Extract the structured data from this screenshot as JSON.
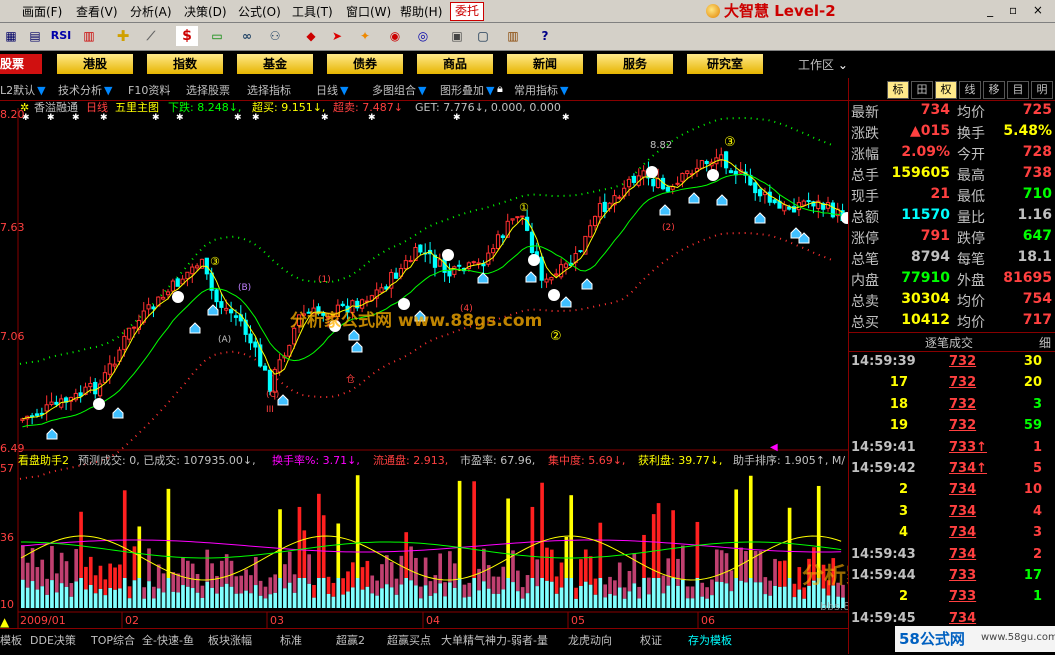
{
  "menu": {
    "items": [
      "画面(F)",
      "查看(V)",
      "分析(A)",
      "决策(D)",
      "公式(O)",
      "工具(T)",
      "窗口(W)",
      "帮助(H)"
    ],
    "entrust": "委托"
  },
  "logo": {
    "text": "大智慧 Level-2"
  },
  "toolbar": {
    "icons": [
      "grid-icon",
      "chart-icon",
      "rsi-icon",
      "indicator-icon",
      "crosshair-icon",
      "ruler-icon",
      "dollar-icon",
      "tape-icon",
      "binoculars-icon",
      "people-icon",
      "diamond-icon",
      "arrow-icon",
      "cross-icon",
      "clipboard-icon",
      "window-icon",
      "books-icon",
      "help-icon"
    ],
    "rsi_label": "RSI",
    "dollar_label": "$"
  },
  "tabs": {
    "left": "股票",
    "items": [
      "港股",
      "指数",
      "基金",
      "债券",
      "商品",
      "新闻",
      "服务",
      "研究室"
    ],
    "workarea": "工作区"
  },
  "indbar": {
    "items": [
      "L2默认",
      "技术分析",
      "F10资料",
      "选择股票",
      "选择指标",
      "日线",
      "多图组合",
      "图形叠加",
      "常用指标"
    ]
  },
  "chart": {
    "header": {
      "name": "香溢融通",
      "period": "日线",
      "indicator": "五里主图",
      "p1": "下跌: 8.248↓,",
      "p2": "超买: 9.151↓,",
      "p3": "超卖: 7.487↓",
      "p4": "GET: 7.776↓, 0.000, 0.000"
    },
    "price_ticks": [
      "8.20",
      "7.63",
      "7.06",
      "6.49"
    ],
    "annot": {
      "high": "8.82",
      "c1": "①",
      "c2": "②",
      "c3a": "③",
      "c3b": "③",
      "A": "(A)",
      "B": "(B)",
      "C": "(C)",
      "III": "III",
      "one": "(1)",
      "two": "(2)",
      "four": "(4)",
      "cang": "仓"
    },
    "watermark": "分析家公式网 www.88gs.com",
    "sub_header": {
      "name": "看盘助手2",
      "t1": "预测成交: 0, 已成交: 107935.00↓,",
      "t2": "换手率%: 3.71↓,",
      "t3": "流通盘: 2.913,",
      "t4": "市盈率: 67.96,",
      "t5": "集中度: 5.69↓,",
      "t6": "获利盘: 39.77↓,",
      "t7": "助手排序: 1.905↑, M/"
    },
    "vol_ticks": [
      "57",
      "36",
      "10"
    ],
    "date_labels": [
      "2009/01",
      "02",
      "03",
      "04",
      "05",
      "06"
    ],
    "watermark2": "分析家论坛",
    "watermark3": "bbs.88gs.com"
  },
  "chart_data": {
    "type": "candlestick",
    "title": "香溢融通",
    "x_start": "2009/01",
    "months": [
      "2009/01",
      "02",
      "03",
      "04",
      "05",
      "06"
    ],
    "ylim": [
      6.2,
      8.4
    ],
    "high_mark": 8.82
  },
  "rpanel": {
    "tabs": [
      "标",
      "田",
      "权",
      "线",
      "移",
      "目",
      "明"
    ],
    "quote": [
      {
        "l1": "最新",
        "v1": "734",
        "l2": "均价",
        "v2": "725",
        "c1": "#ff4040",
        "c2": "#ff4040"
      },
      {
        "l1": "涨跌",
        "v1": "▲015",
        "l2": "换手",
        "v2": "5.48%",
        "c1": "#ff4040",
        "c2": "#ffff00"
      },
      {
        "l1": "涨幅",
        "v1": "2.09%",
        "l2": "今开",
        "v2": "728",
        "c1": "#ff4040",
        "c2": "#ff4040"
      },
      {
        "l1": "总手",
        "v1": "159605",
        "l2": "最高",
        "v2": "738",
        "c1": "#ffff00",
        "c2": "#ff4040"
      },
      {
        "l1": "现手",
        "v1": "21",
        "l2": "最低",
        "v2": "710",
        "c1": "#ff4040",
        "c2": "#00ff00"
      },
      {
        "l1": "总额",
        "v1": "11570",
        "l2": "量比",
        "v2": "1.16",
        "c1": "#00ffff",
        "c2": "#c0c0c0"
      },
      {
        "l1": "涨停",
        "v1": "791",
        "l2": "跌停",
        "v2": "647",
        "c1": "#ff4040",
        "c2": "#00ff00"
      },
      {
        "l1": "总笔",
        "v1": "8794",
        "l2": "每笔",
        "v2": "18.1",
        "c1": "#c0c0c0",
        "c2": "#c0c0c0"
      },
      {
        "l1": "内盘",
        "v1": "77910",
        "l2": "外盘",
        "v2": "81695",
        "c1": "#00ff00",
        "c2": "#ff4040"
      },
      {
        "l1": "总卖",
        "v1": "30304",
        "l2": "均价",
        "v2": "754",
        "c1": "#ffff00",
        "c2": "#ff4040"
      },
      {
        "l1": "总买",
        "v1": "10412",
        "l2": "均价",
        "v2": "717",
        "c1": "#ffff00",
        "c2": "#ff4040"
      }
    ],
    "tick_title": "逐笔成交",
    "tick_tab": "细",
    "ticks": [
      {
        "time": "14:59:39",
        "price": "732",
        "vol": "30",
        "vc": "#ffff00"
      },
      {
        "time": "17",
        "price": "732",
        "vol": "20",
        "vc": "#ffff00"
      },
      {
        "time": "18",
        "price": "732",
        "vol": "3",
        "vc": "#00ff00"
      },
      {
        "time": "19",
        "price": "732",
        "vol": "59",
        "vc": "#00ff00"
      },
      {
        "time": "14:59:41",
        "price": "733↑",
        "vol": "1",
        "vc": "#ff4040"
      },
      {
        "time": "14:59:42",
        "price": "734↑",
        "vol": "5",
        "vc": "#ff4040"
      },
      {
        "time": "2",
        "price": "734",
        "vol": "10",
        "vc": "#ff4040"
      },
      {
        "time": "3",
        "price": "734",
        "vol": "4",
        "vc": "#ff4040"
      },
      {
        "time": "4",
        "price": "734",
        "vol": "3",
        "vc": "#ff4040"
      },
      {
        "time": "14:59:43",
        "price": "734",
        "vol": "2",
        "vc": "#ff4040"
      },
      {
        "time": "14:59:44",
        "price": "733",
        "vol": "17",
        "vc": "#00ff00"
      },
      {
        "time": "2",
        "price": "733",
        "vol": "1",
        "vc": "#00ff00"
      },
      {
        "time": "14:59:45",
        "price": "734",
        "vol": "",
        "vc": "#ff4040"
      }
    ],
    "brand": "58公式网",
    "brand_url": "www.58gu.com"
  },
  "bottom": {
    "items": [
      "模板",
      "DDE决策",
      "TOP综合",
      "全-快速-鱼",
      "板块涨幅",
      "标准",
      "超赢2",
      "超赢买点",
      "大单精气神力-弱者-量",
      "龙虎动向",
      "权证",
      "存为模板"
    ]
  }
}
